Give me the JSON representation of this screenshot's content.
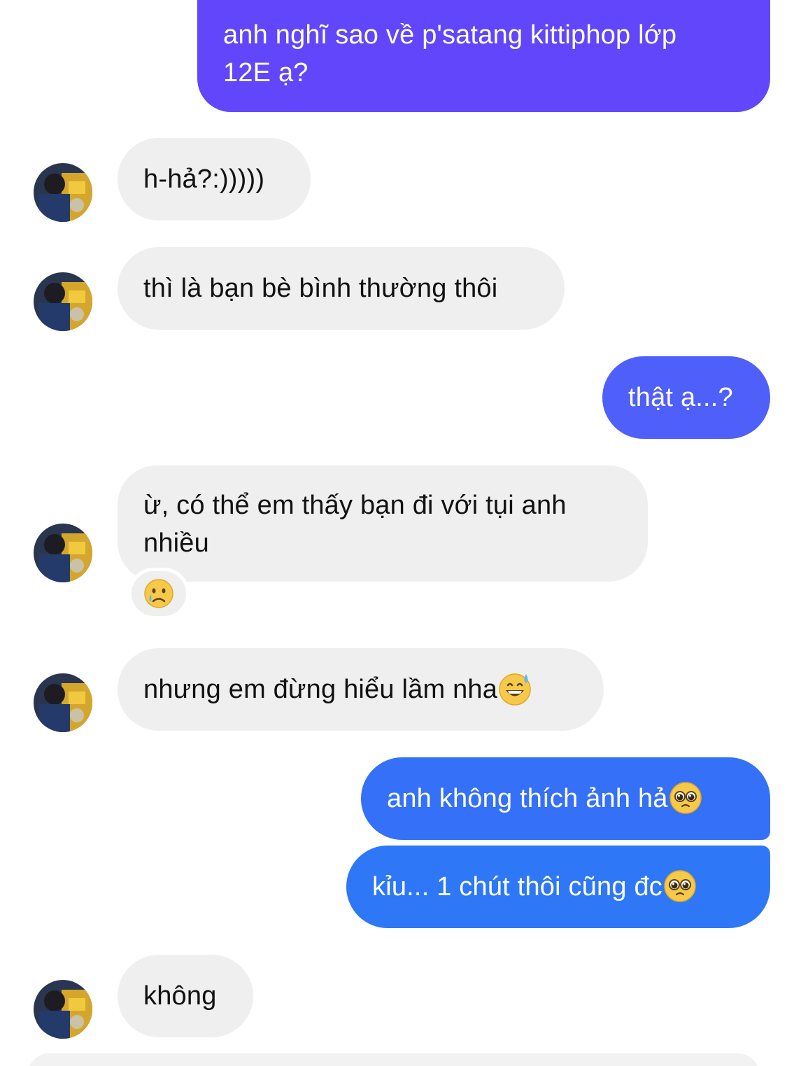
{
  "messages": [
    {
      "sender": "me",
      "text": "anh nghĩ sao về p'satang kittiphop lớp",
      "text2": "12E ạ?"
    },
    {
      "sender": "them",
      "text": "h-hả?:)))))"
    },
    {
      "sender": "them",
      "text": "thì là bạn bè bình thường thôi"
    },
    {
      "sender": "me",
      "text": "thật ạ...?"
    },
    {
      "sender": "them",
      "text": "ừ, có thể em thấy bạn đi với tụi anh",
      "text2": "nhiều",
      "reaction": "crying-face-emoji"
    },
    {
      "sender": "them",
      "text": "nhưng em đừng hiểu lầm nha",
      "emoji": "grinning-sweat-emoji"
    },
    {
      "sender": "me",
      "text": "anh không thích ảnh hả",
      "emoji": "pleading-face-emoji"
    },
    {
      "sender": "me",
      "text": "kỉu... 1 chút thôi cũng đc",
      "emoji": "pleading-face-emoji"
    },
    {
      "sender": "them",
      "text": "không"
    }
  ],
  "colors": {
    "outgoing_top": "#6246fb",
    "outgoing_mid": "#4f5ffa",
    "outgoing_bottom": "#2e78f7",
    "incoming": "#efefef"
  }
}
